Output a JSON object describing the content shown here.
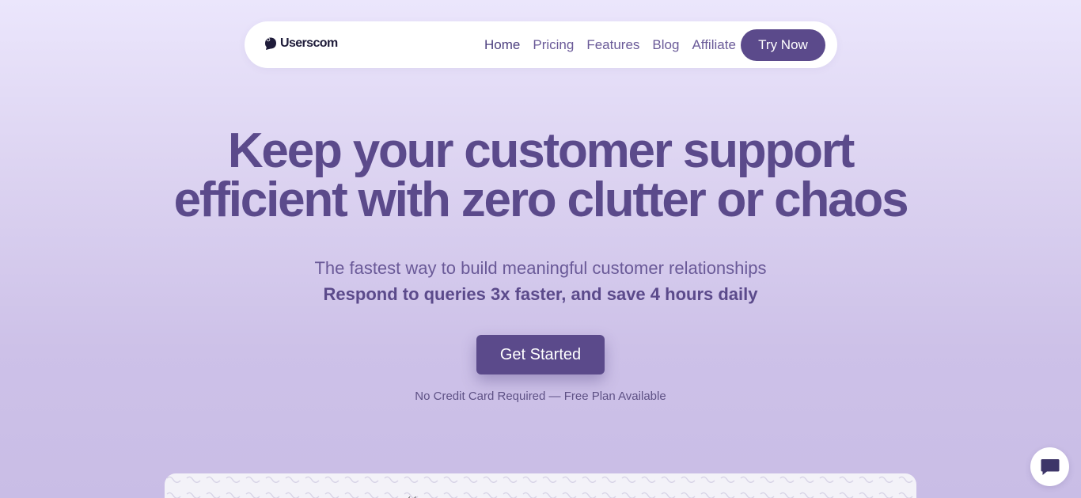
{
  "nav": {
    "brand": "Userscom",
    "links": [
      {
        "label": "Home",
        "active": true
      },
      {
        "label": "Pricing"
      },
      {
        "label": "Features"
      },
      {
        "label": "Blog"
      },
      {
        "label": "Affiliate"
      }
    ],
    "cta_label": "Try Now"
  },
  "hero": {
    "headline_line1": "Keep your customer support",
    "headline_line2": "efficient with zero clutter or chaos",
    "subtitle": "The fastest way to build meaningful customer relationships",
    "subtitle_bold": "Respond to queries 3x faster, and save 4 hours daily",
    "cta_label": "Get Started",
    "note": "No Credit Card Required — Free Plan Available"
  },
  "preview": {
    "partial_text": "‹ ‹"
  },
  "icons": {
    "logo": "chat-bubble-logo-icon",
    "chat_launcher": "chat-bubble-icon"
  },
  "colors": {
    "brand_purple": "#5b4a8b",
    "link_purple": "#6a5a98",
    "logo_text": "#1f1c3a",
    "background_top": "#ebe6fc",
    "background_bottom": "#c9bde6"
  }
}
